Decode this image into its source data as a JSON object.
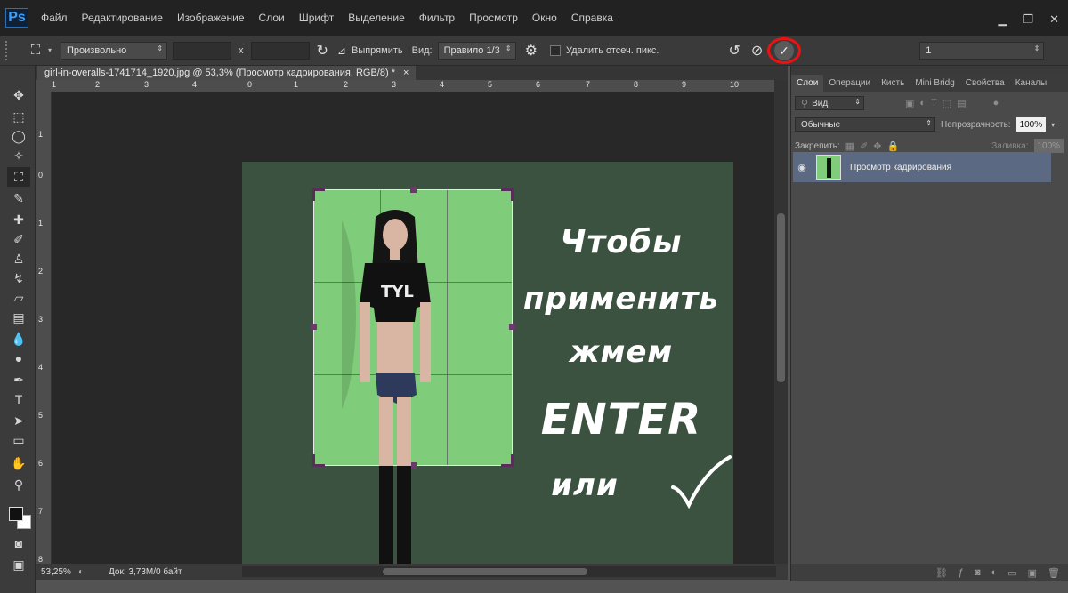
{
  "app": {
    "logo": "Ps"
  },
  "menu": [
    "Файл",
    "Редактирование",
    "Изображение",
    "Слои",
    "Шрифт",
    "Выделение",
    "Фильтр",
    "Просмотр",
    "Окно",
    "Справка"
  ],
  "window_controls": {
    "minimize_icon": "minimize-icon",
    "restore_icon": "restore-icon",
    "close_icon": "close-icon"
  },
  "options": {
    "ratio_value": "Произвольно",
    "times_sign": "x",
    "straighten_label": "Выпрямить",
    "view_label": "Вид:",
    "view_value": "Правило 1/3",
    "delete_pixels_label": "Удалить отсеч. пикс.",
    "right_field_value": "1",
    "commit_symbol": "✓",
    "commit_highlight_color": "#e11111"
  },
  "document": {
    "tab_title": "girl-in-overalls-1741714_1920.jpg @ 53,3% (Просмотр кадрирования, RGB/8) *",
    "tab_close": "×",
    "ruler_h": [
      "1",
      "2",
      "3",
      "4",
      "5",
      "6",
      "7",
      "8",
      "9",
      "10"
    ],
    "ruler_h_zero": "0",
    "ruler_v": [
      "1",
      "0",
      "1",
      "2",
      "3",
      "4",
      "5",
      "6",
      "7",
      "8"
    ]
  },
  "overlay": {
    "line1": "Чтобы",
    "line2": "применить",
    "line3": "жмем",
    "line4": "ENTER",
    "line5": "или"
  },
  "status": {
    "zoom": "53,25%",
    "doc_size": "Док: 3,73M/0 байт"
  },
  "panel": {
    "tabs": [
      "Слои",
      "Операции",
      "Кисть",
      "Mini Bridg",
      "Свойства",
      "Каналы"
    ],
    "filter_value": "Вид",
    "blend_mode": "Обычные",
    "opacity_label": "Непрозрачность:",
    "opacity_value": "100%",
    "lock_label": "Закрепить:",
    "fill_label": "Заливка:",
    "fill_value": "100%",
    "layer_name": "Просмотр кадрирования"
  },
  "colors": {
    "accent_highlight": "#e11111",
    "crop_fill": "#7fcc7a",
    "image_bg": "#3c5240",
    "layer_selected": "#5b6a82"
  }
}
